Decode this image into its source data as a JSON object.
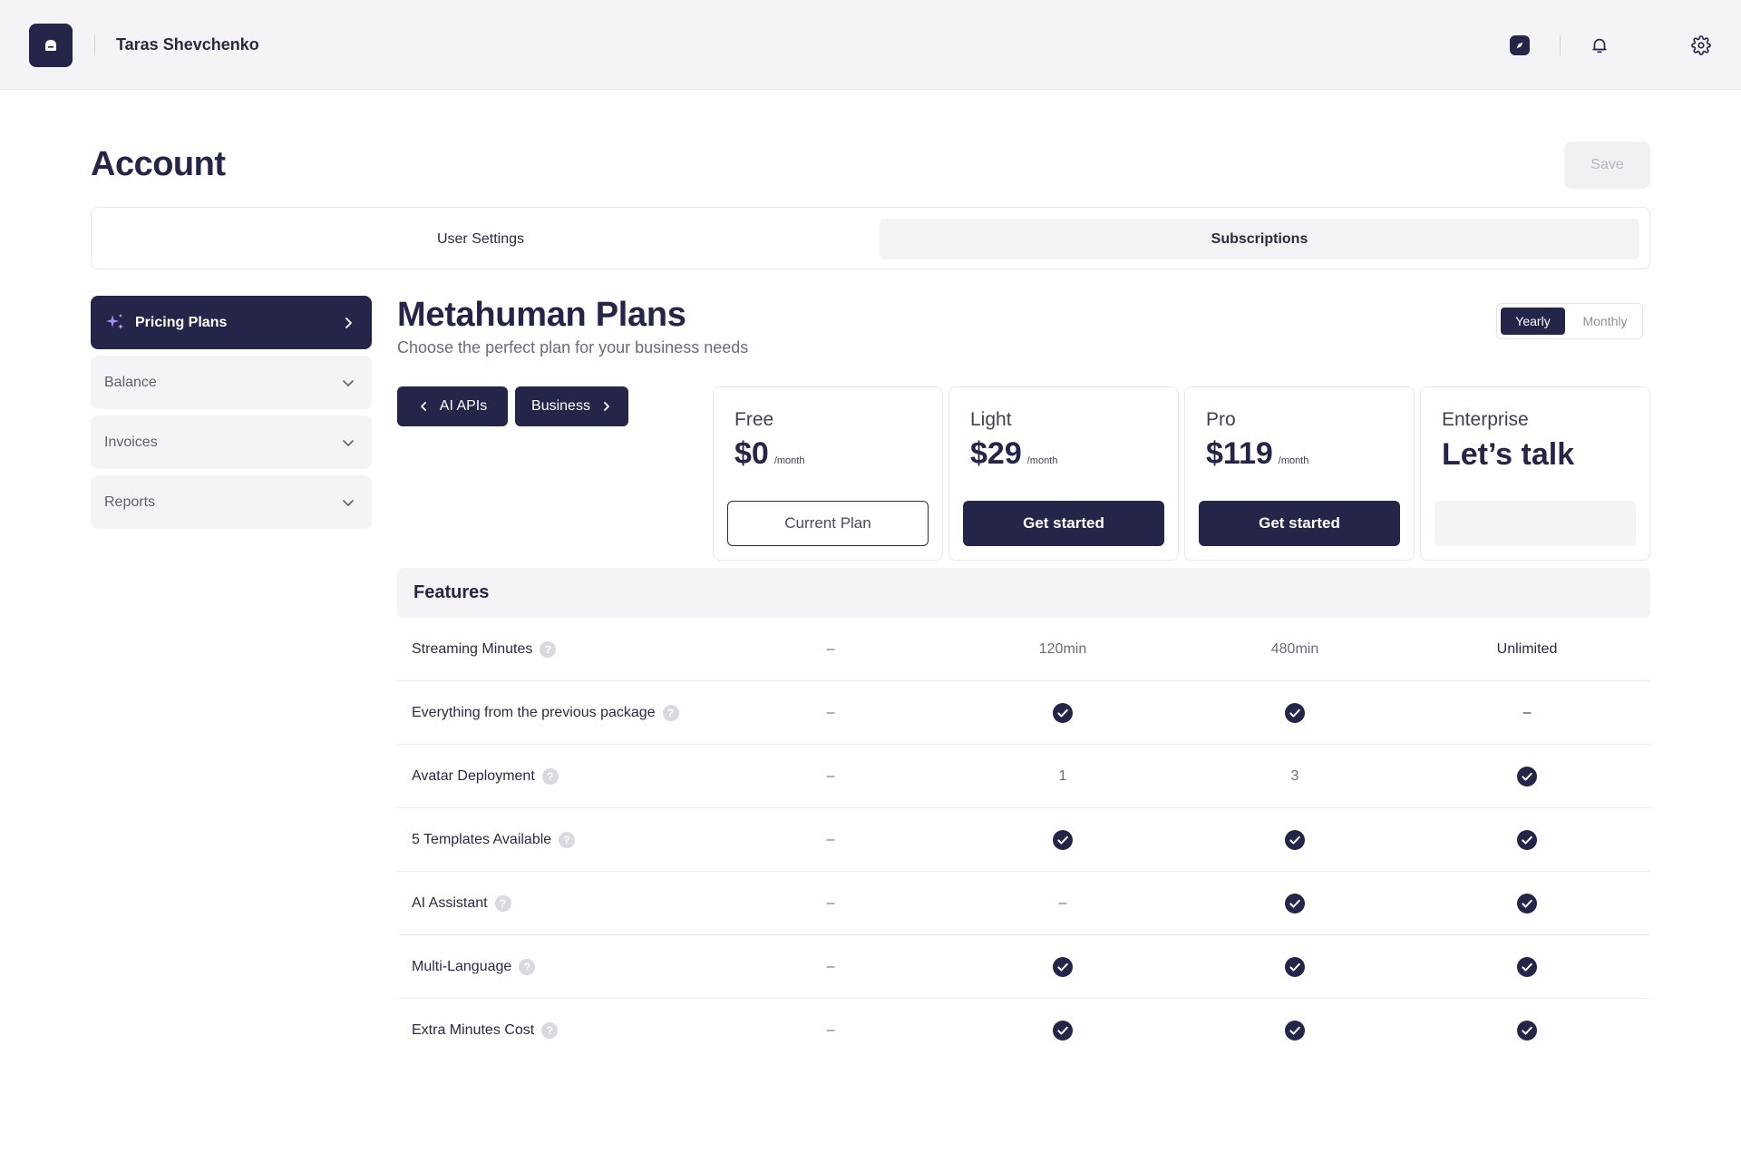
{
  "header": {
    "user_name": "Taras Shevchenko"
  },
  "page": {
    "title": "Account",
    "save_label": "Save"
  },
  "tabs": [
    {
      "label": "User Settings",
      "active": false
    },
    {
      "label": "Subscriptions",
      "active": true
    }
  ],
  "sidebar": {
    "items": [
      {
        "label": "Pricing Plans",
        "active": true,
        "icon": "sparkle-icon"
      },
      {
        "label": "Balance",
        "active": false
      },
      {
        "label": "Invoices",
        "active": false
      },
      {
        "label": "Reports",
        "active": false
      }
    ]
  },
  "plans": {
    "title": "Metahuman Plans",
    "subtitle": "Choose the perfect plan for your business needs",
    "billing_toggle": {
      "yearly": "Yearly",
      "monthly": "Monthly",
      "selected": "Yearly"
    },
    "nav": {
      "prev_label": "AI APIs",
      "next_label": "Business"
    },
    "cards": [
      {
        "name": "Free",
        "price": "$0",
        "per": "/month",
        "button": "Current Plan"
      },
      {
        "name": "Light",
        "price": "$29",
        "per": "/month",
        "button": "Get started"
      },
      {
        "name": "Pro",
        "price": "$119",
        "per": "/month",
        "button": "Get started"
      },
      {
        "name": "Enterprise",
        "price": "Let’s talk",
        "per": "",
        "button": ""
      }
    ]
  },
  "features": {
    "title": "Features",
    "help_glyph": "?",
    "rows": [
      {
        "name": "Streaming Minutes",
        "values": [
          "–",
          "120min",
          "480min",
          "Unlimited"
        ]
      },
      {
        "name": "Everything from the previous package",
        "values": [
          "–",
          "check",
          "check",
          "–"
        ]
      },
      {
        "name": "Avatar Deployment",
        "values": [
          "–",
          "1",
          "3",
          "check"
        ]
      },
      {
        "name": "5 Templates Available",
        "values": [
          "–",
          "check",
          "check",
          "check"
        ]
      },
      {
        "name": "AI Assistant",
        "values": [
          "–",
          "–",
          "check",
          "check"
        ]
      },
      {
        "name": "Multi-Language",
        "values": [
          "–",
          "check",
          "check",
          "check"
        ]
      },
      {
        "name": "Extra Minutes Cost",
        "values": [
          "–",
          "check",
          "check",
          "check"
        ]
      }
    ]
  },
  "colors": {
    "primary": "#25254a",
    "background": "#ffffff",
    "muted_surface": "#f4f4f6",
    "sparkle": "#a78bfa"
  }
}
